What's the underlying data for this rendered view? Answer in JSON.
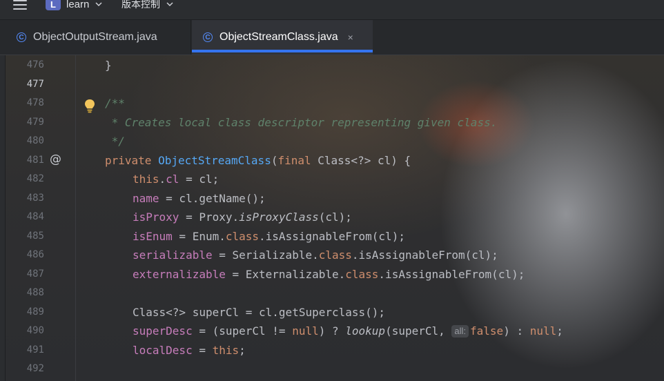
{
  "topbar": {
    "menu_icon": "hamburger-icon",
    "project_badge": "L",
    "project_name": "learn",
    "vcs_label": "版本控制"
  },
  "tabs": [
    {
      "label": "ObjectOutputStream.java",
      "icon": "class-icon",
      "active": false
    },
    {
      "label": "ObjectStreamClass.java",
      "icon": "class-icon",
      "active": true,
      "close": "×"
    }
  ],
  "colors": {
    "accent": "#3574f0",
    "keyword": "#cf8e6d",
    "method": "#56a8f5",
    "field": "#c77dbb",
    "comment": "#5f826b"
  },
  "editor": {
    "current_line": "477",
    "gutter_marker": "@",
    "inlay_hint": "all:",
    "line_numbers": [
      "476",
      "477",
      "478",
      "479",
      "480",
      "481",
      "482",
      "483",
      "484",
      "485",
      "486",
      "487",
      "488",
      "489",
      "490",
      "491",
      "492"
    ],
    "lines": {
      "l476": "}",
      "l478": "/**",
      "l479": " * Creates local class descriptor representing given class.",
      "l480": " */",
      "l481": {
        "a": "private ",
        "b": "ObjectStreamClass",
        "c": "(",
        "d": "final ",
        "e": "Class<?> cl) {"
      },
      "l482": {
        "a": "this",
        "b": ".",
        "c": "cl",
        "d": " = cl;"
      },
      "l483": {
        "a": "name",
        "b": " = cl.getName();"
      },
      "l484": {
        "a": "isProxy",
        "b": " = Proxy.",
        "c": "isProxyClass",
        "d": "(cl);"
      },
      "l485": {
        "a": "isEnum",
        "b": " = Enum.",
        "c": "class",
        "d": ".isAssignableFrom(cl);"
      },
      "l486": {
        "a": "serializable",
        "b": " = Serializable.",
        "c": "class",
        "d": ".isAssignableFrom(cl);"
      },
      "l487": {
        "a": "externalizable",
        "b": " = Externalizable.",
        "c": "class",
        "d": ".isAssignableFrom(cl);"
      },
      "l489": "Class<?> superCl = cl.getSuperclass();",
      "l490": {
        "a": "superDesc",
        "b": " = (superCl != ",
        "c": "null",
        "d": ") ? ",
        "e": "lookup",
        "f": "(superCl, ",
        "g": "false",
        "h": ") : ",
        "i": "null",
        "j": ";"
      },
      "l491": {
        "a": "localDesc",
        "b": " = ",
        "c": "this",
        "d": ";"
      }
    }
  }
}
